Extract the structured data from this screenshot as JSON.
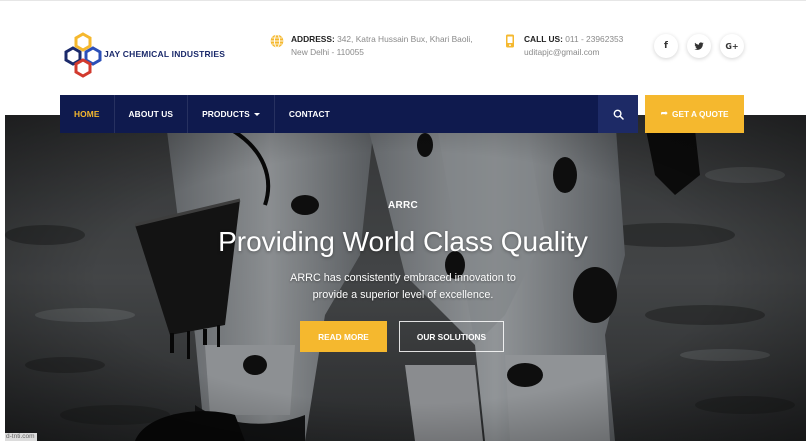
{
  "brand": {
    "name": "JAY CHEMICAL INDUSTRIES",
    "colors": {
      "navy": "#1b2a6b",
      "gold": "#f5b82e",
      "red": "#d23a2e",
      "blue": "#2b4fb8"
    }
  },
  "header": {
    "address": {
      "icon": "globe-icon",
      "label": "ADDRESS:",
      "line1": "342, Katra Hussain Bux, Khari Baoli,",
      "line2": "New Delhi - 110055"
    },
    "call": {
      "icon": "phone-icon",
      "label": "CALL US:",
      "line1": "011 - 23962353",
      "line2": "uditapjc@gmail.com"
    },
    "social": [
      {
        "icon": "facebook-icon",
        "glyph": "f"
      },
      {
        "icon": "twitter-icon",
        "glyph": "🐦"
      },
      {
        "icon": "google-plus-icon",
        "glyph": "G+"
      }
    ]
  },
  "nav": {
    "items": [
      {
        "label": "HOME",
        "active": true
      },
      {
        "label": "ABOUT US",
        "active": false
      },
      {
        "label": "PRODUCTS",
        "active": false,
        "dropdown": true
      },
      {
        "label": "CONTACT",
        "active": false
      }
    ],
    "search_icon": "search-icon",
    "quote_label": "GET A QUOTE",
    "quote_icon": "share-arrow-icon"
  },
  "hero": {
    "kicker": "ARRC",
    "title": "Providing World Class Quality",
    "subtitle_line1": "ARRC has consistently embraced innovation to",
    "subtitle_line2": "provide a superior level of excellence.",
    "primary_button": "READ MORE",
    "secondary_button": "OUR SOLUTIONS"
  },
  "watermark": "d-tnti.com"
}
